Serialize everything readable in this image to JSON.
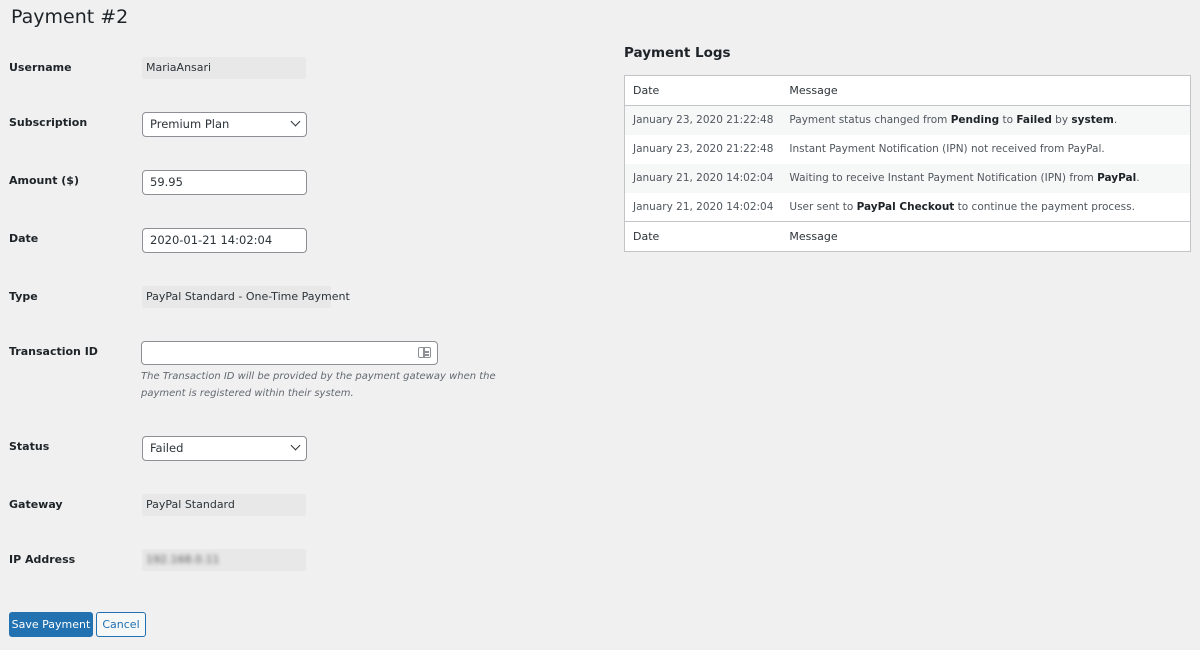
{
  "page": {
    "title": "Payment #2"
  },
  "form": {
    "username": {
      "label": "Username",
      "value": "MariaAnsari"
    },
    "subscription": {
      "label": "Subscription",
      "selected": "Premium Plan"
    },
    "amount": {
      "label": "Amount ($)",
      "value": "59.95"
    },
    "date": {
      "label": "Date",
      "value": "2020-01-21 14:02:04"
    },
    "type": {
      "label": "Type",
      "value": "PayPal Standard - One-Time Payment"
    },
    "transaction_id": {
      "label": "Transaction ID",
      "value": "",
      "icon": "card-icon",
      "description": "The Transaction ID will be provided by the payment gateway when the payment is registered within their system."
    },
    "status": {
      "label": "Status",
      "selected": "Failed"
    },
    "gateway": {
      "label": "Gateway",
      "value": "PayPal Standard"
    },
    "ip_address": {
      "label": "IP Address",
      "value": "192.168.0.11"
    }
  },
  "buttons": {
    "save_label": "Save Payment",
    "cancel_label": "Cancel"
  },
  "logs": {
    "title": "Payment Logs",
    "columns": [
      "Date",
      "Message"
    ],
    "rows": [
      {
        "date": "January 23, 2020 21:22:48",
        "message": [
          {
            "t": "Payment status changed from "
          },
          {
            "t": "Pending",
            "b": true
          },
          {
            "t": " to "
          },
          {
            "t": "Failed",
            "b": true
          },
          {
            "t": " by "
          },
          {
            "t": "system",
            "b": true
          },
          {
            "t": "."
          }
        ]
      },
      {
        "date": "January 23, 2020 21:22:48",
        "message": [
          {
            "t": "Instant Payment Notification (IPN) not received from PayPal."
          }
        ]
      },
      {
        "date": "January 21, 2020 14:02:04",
        "message": [
          {
            "t": "Waiting to receive Instant Payment Notification (IPN) from "
          },
          {
            "t": "PayPal",
            "b": true
          },
          {
            "t": "."
          }
        ]
      },
      {
        "date": "January 21, 2020 14:02:04",
        "message": [
          {
            "t": "User sent to "
          },
          {
            "t": "PayPal Checkout",
            "b": true
          },
          {
            "t": " to continue the payment process."
          }
        ]
      }
    ]
  }
}
